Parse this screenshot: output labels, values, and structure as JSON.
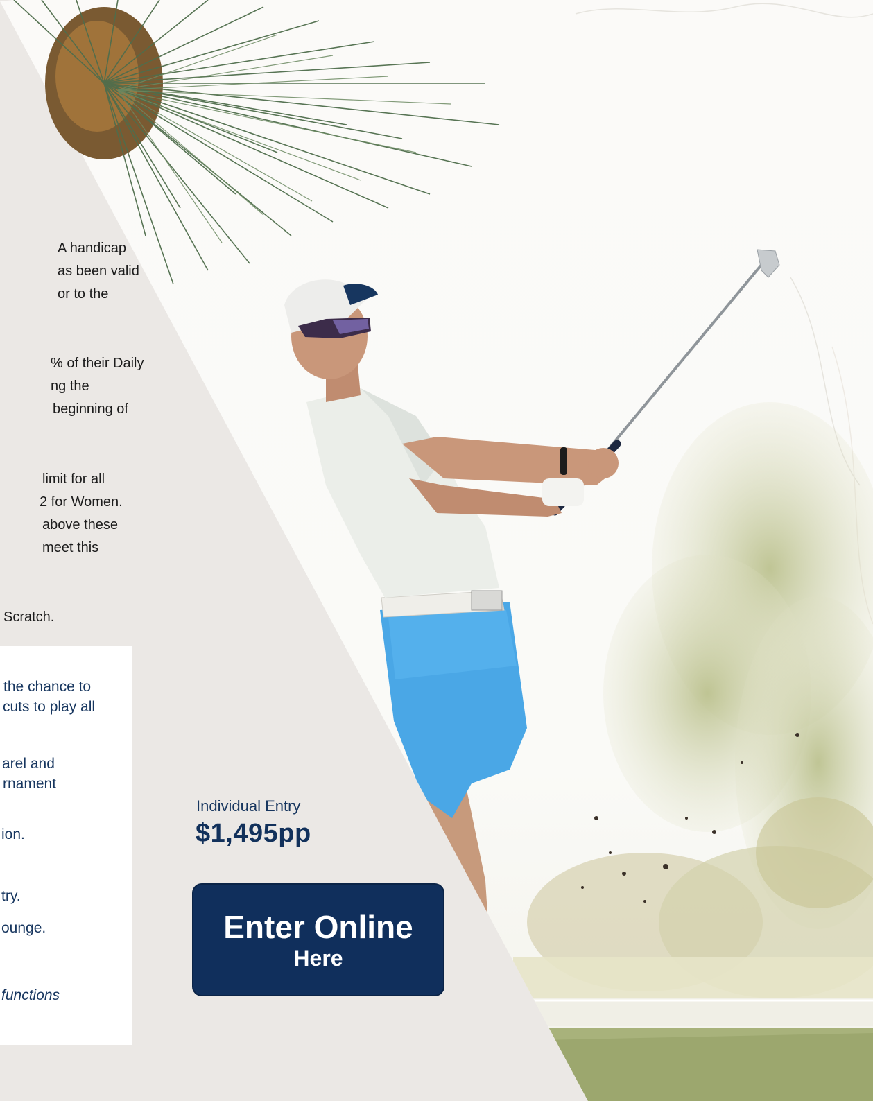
{
  "handicap_rules": [
    {
      "lines": [
        "A handicap",
        "as been valid",
        "or to the"
      ]
    },
    {
      "lines": [
        "% of their Daily",
        "ng the",
        "beginning of"
      ]
    },
    {
      "lines": [
        "limit for all",
        "2 for Women.",
        "above these",
        "meet this"
      ]
    },
    {
      "lines": [
        "Scratch."
      ]
    }
  ],
  "inclusions": [
    {
      "lines": [
        "the chance to",
        "cuts to play all"
      ],
      "italic": false
    },
    {
      "lines": [
        "arel and",
        "rnament"
      ],
      "italic": false
    },
    {
      "lines": [
        "ion."
      ],
      "italic": false
    },
    {
      "lines": [
        "try."
      ],
      "italic": false
    },
    {
      "lines": [
        "ounge."
      ],
      "italic": false
    },
    {
      "lines": [
        "functions"
      ],
      "italic": true
    }
  ],
  "entry": {
    "label": "Individual Entry",
    "price": "$1,495pp"
  },
  "cta": {
    "line1": "Enter Online",
    "line2": "Here"
  },
  "colors": {
    "navy": "#102f5c",
    "panel_beige": "#ebe8e5",
    "shorts_blue": "#4aa7e6"
  },
  "icons": {
    "palm": "palm-frond-icon",
    "golfer": "golfer-photo-icon"
  }
}
